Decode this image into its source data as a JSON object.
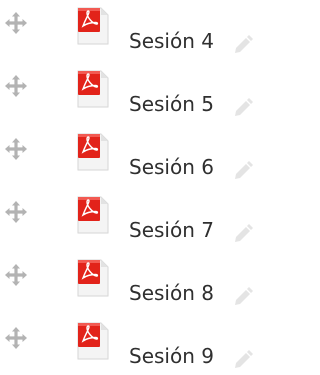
{
  "items": [
    {
      "label": "Sesión 4",
      "move_icon": "move-icon",
      "file_icon": "pdf-file-icon",
      "edit_icon": "pencil-icon"
    },
    {
      "label": "Sesión 5",
      "move_icon": "move-icon",
      "file_icon": "pdf-file-icon",
      "edit_icon": "pencil-icon"
    },
    {
      "label": "Sesión 6",
      "move_icon": "move-icon",
      "file_icon": "pdf-file-icon",
      "edit_icon": "pencil-icon"
    },
    {
      "label": "Sesión 7",
      "move_icon": "move-icon",
      "file_icon": "pdf-file-icon",
      "edit_icon": "pencil-icon"
    },
    {
      "label": "Sesión 8",
      "move_icon": "move-icon",
      "file_icon": "pdf-file-icon",
      "edit_icon": "pencil-icon"
    },
    {
      "label": "Sesión 9",
      "move_icon": "move-icon",
      "file_icon": "pdf-file-icon",
      "edit_icon": "pencil-icon"
    }
  ],
  "colors": {
    "move_icon": "#b3b3b3",
    "pdf_red": "#e2231a",
    "pdf_paper": "#f4f4f4",
    "pencil": "#e4e4e4",
    "text": "#2f2f2f"
  }
}
